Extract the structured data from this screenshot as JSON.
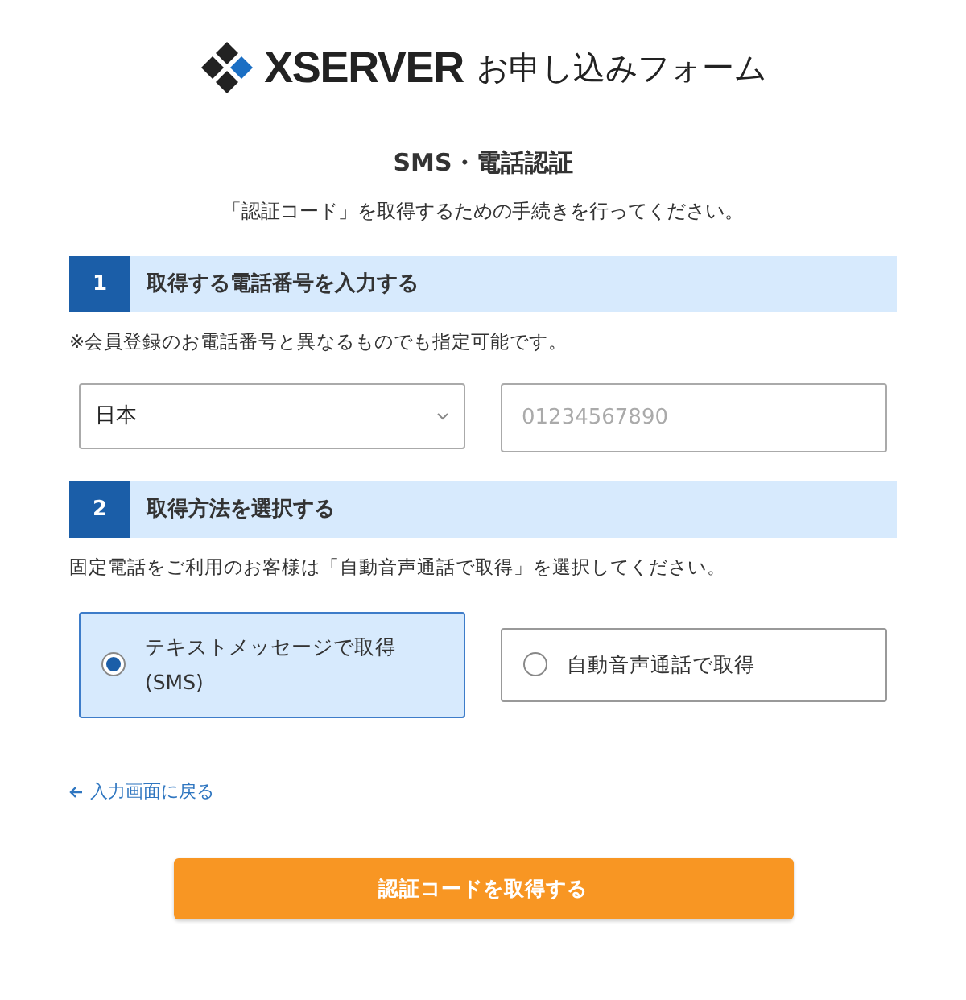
{
  "header": {
    "brand": "XSERVER",
    "form_title": "お申し込みフォーム"
  },
  "title": "SMS・電話認証",
  "subtitle": "「認証コード」を取得するための手続きを行ってください。",
  "sections": [
    {
      "number": "1",
      "heading": "取得する電話番号を入力する",
      "note": "※会員登録のお電話番号と異なるものでも指定可能です。"
    },
    {
      "number": "2",
      "heading": "取得方法を選択する",
      "note": "固定電話をご利用のお客様は「自動音声通話で取得」を選択してください。"
    }
  ],
  "country_select": {
    "value": "日本"
  },
  "phone_field": {
    "placeholder": "01234567890"
  },
  "methods": [
    {
      "label": "テキストメッセージで取得 (SMS)",
      "selected": true
    },
    {
      "label": "自動音声通話で取得",
      "selected": false
    }
  ],
  "back_link": "入力画面に戻る",
  "submit_button": "認証コードを取得する"
}
